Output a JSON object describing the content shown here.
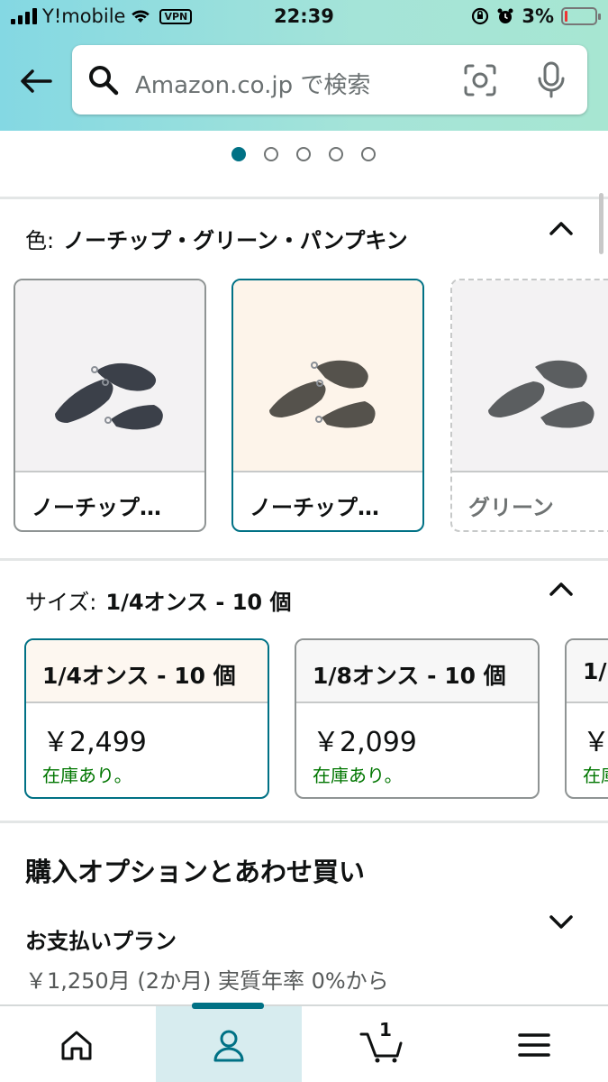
{
  "status_bar": {
    "carrier": "Y!mobile",
    "vpn": "VPN",
    "time": "22:39",
    "battery": "3%"
  },
  "header": {
    "search_placeholder": "Amazon.co.jp で検索",
    "icons": [
      "back-arrow-icon",
      "search-icon",
      "camera-scan-icon",
      "microphone-icon"
    ]
  },
  "carousel": {
    "total": 5,
    "active": 1
  },
  "color_section": {
    "label": "色:",
    "selected_value": "ノーチップ・グリーン・パンプキン",
    "options": [
      {
        "name": "ノーチップ…",
        "state": "default"
      },
      {
        "name": "ノーチップ…",
        "state": "selected"
      },
      {
        "name": "グリーン",
        "state": "unavailable"
      }
    ]
  },
  "size_section": {
    "label": "サイズ:",
    "selected_value": "1/4オンス - 10 個",
    "options": [
      {
        "name": "1/4オンス - 10 個",
        "price": "￥2,499",
        "stock": "在庫あり。",
        "state": "selected"
      },
      {
        "name": "1/8オンス - 10 個",
        "price": "￥2,099",
        "stock": "在庫あり。",
        "state": "default"
      },
      {
        "name": "1/",
        "price": "￥",
        "stock": "在庫",
        "state": "default"
      }
    ]
  },
  "purchase_options": {
    "title": "購入オプションとあわせ買い",
    "payment_plan_title": "お支払いプラン",
    "payment_plan_detail": "￥1,250月 (2か月) 実質年率 0%から"
  },
  "bottom_nav": {
    "items": [
      "home-icon",
      "account-icon",
      "cart-icon",
      "menu-icon"
    ],
    "cart_count": "1",
    "active_item": "account-icon"
  },
  "colors": {
    "accent": "#007185",
    "in_stock": "#007600",
    "header_gradient_start": "#84d8e3",
    "header_gradient_end": "#a7e6d2"
  }
}
